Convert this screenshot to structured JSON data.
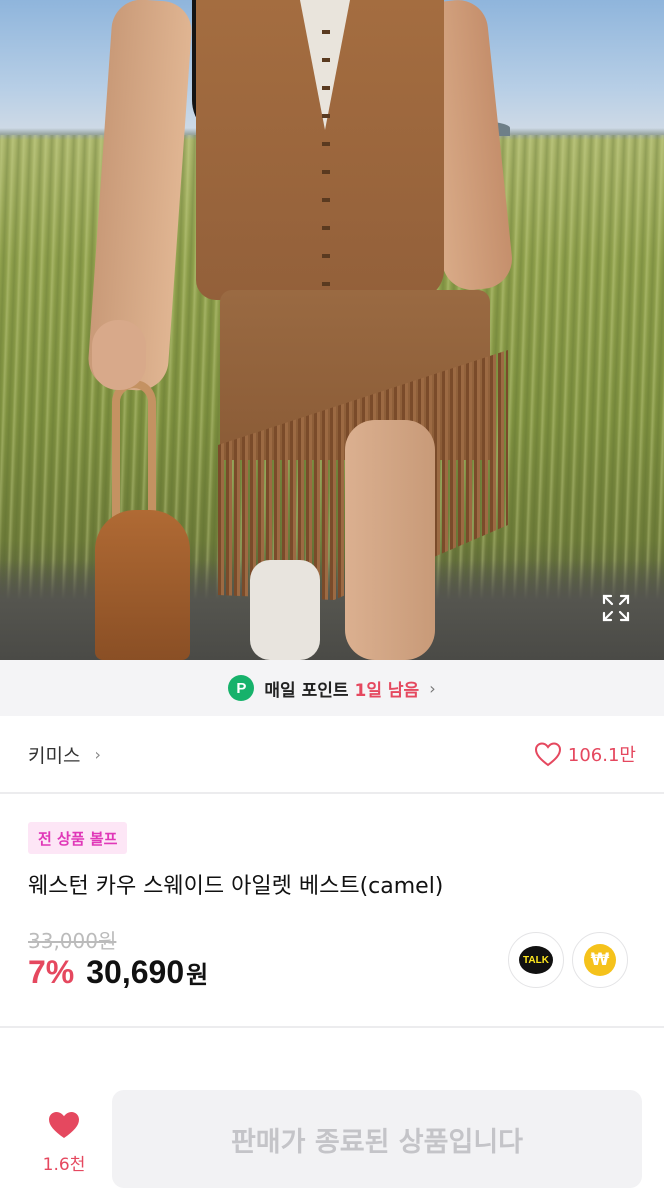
{
  "hero": {
    "image_alt": "",
    "expand_icon": "expand-icon"
  },
  "point_banner": {
    "badge": "P",
    "text": "매일 포인트",
    "remaining": "1일 남음",
    "chevron": "›"
  },
  "shop": {
    "name": "키미스",
    "chevron": "›",
    "like_icon": "heart-outline-icon",
    "like_count": "106.1만",
    "accent_color": "#e5485f"
  },
  "product": {
    "promo_badge": "전 상품 볼프",
    "title": "웨스턴 카우 스웨이드 아일렛 베스트(camel)",
    "original_price": "33,000원",
    "discount": "7%",
    "sale_price": "30,690",
    "currency": "원"
  },
  "share": {
    "talk_label": "TALK",
    "won_label": "₩"
  },
  "bottom_bar": {
    "wish_icon": "heart-filled-icon",
    "wish_count": "1.6천",
    "cta_label": "판매가 종료된 상품입니다"
  }
}
